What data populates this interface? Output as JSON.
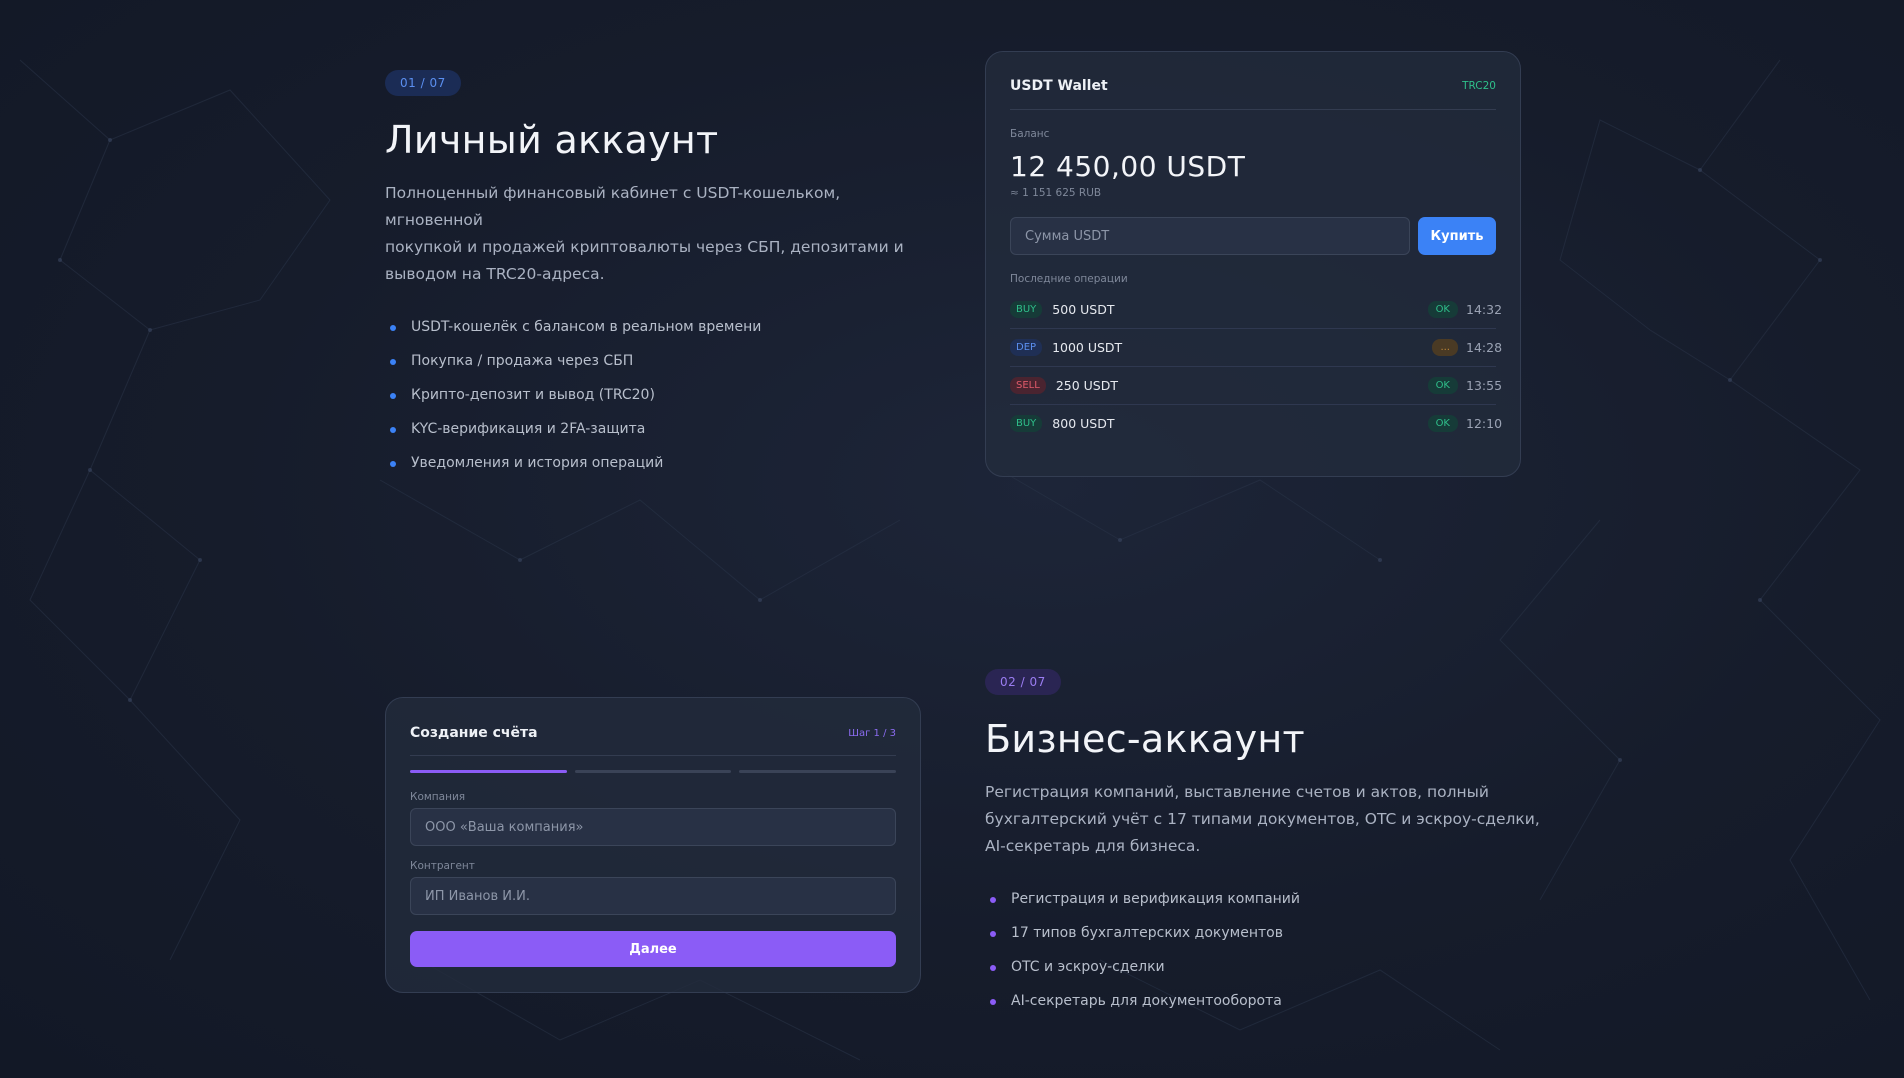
{
  "colors": {
    "accent_blue": "#3b82f6",
    "accent_purple": "#8b5cf6",
    "ok_green": "#2fbf8a",
    "sell_red": "#e05a6a"
  },
  "personal": {
    "badge": "01 / 07",
    "title": "Личный аккаунт",
    "desc_lines": [
      "Полноценный финансовый кабинет с USDT-кошельком, мгновенной",
      "покупкой и продажей криптовалюты через СБП, депозитами и",
      "выводом на TRC20-адреса."
    ],
    "features": [
      "USDT-кошелёк с балансом в реальном времени",
      "Покупка / продажа через СБП",
      "Крипто-депозит и вывод (TRC20)",
      "KYC-верификация и 2FA-защита",
      "Уведомления и история операций"
    ]
  },
  "wallet": {
    "title": "USDT Wallet",
    "network": "TRC20",
    "balance_label": "Баланс",
    "balance": "12 450,00 USDT",
    "balance_rub": "≈ 1 151 625 RUB",
    "amount_placeholder": "Сумма USDT",
    "buy_label": "Купить",
    "ops_label": "Последние операции",
    "ops": [
      {
        "type": "BUY",
        "kind": "buy",
        "amount": "500 USDT",
        "status": "OK",
        "status_kind": "ok",
        "time": "14:32"
      },
      {
        "type": "DEP",
        "kind": "dep",
        "amount": "1000 USDT",
        "status": "...",
        "status_kind": "pend",
        "time": "14:28"
      },
      {
        "type": "SELL",
        "kind": "sell",
        "amount": "250 USDT",
        "status": "OK",
        "status_kind": "ok",
        "time": "13:55"
      },
      {
        "type": "BUY",
        "kind": "buy",
        "amount": "800 USDT",
        "status": "OK",
        "status_kind": "ok",
        "time": "12:10"
      }
    ]
  },
  "account_form": {
    "title": "Создание счёта",
    "step": "Шаг 1 / 3",
    "progress_step": 1,
    "progress_total": 3,
    "company_label": "Компания",
    "company_placeholder": "ООО «Ваша компания»",
    "contractor_label": "Контрагент",
    "contractor_placeholder": "ИП Иванов И.И.",
    "next_label": "Далее"
  },
  "business": {
    "badge": "02 / 07",
    "title": "Бизнес-аккаунт",
    "desc_lines": [
      "Регистрация компаний, выставление счетов и актов, полный",
      "бухгалтерский учёт с 17 типами документов, OTC и эскроу-сделки,",
      "AI-секретарь для бизнеса."
    ],
    "features": [
      "Регистрация и верификация компаний",
      "17 типов бухгалтерских документов",
      "OTC и эскроу-сделки",
      "AI-секретарь для документооборота"
    ]
  }
}
